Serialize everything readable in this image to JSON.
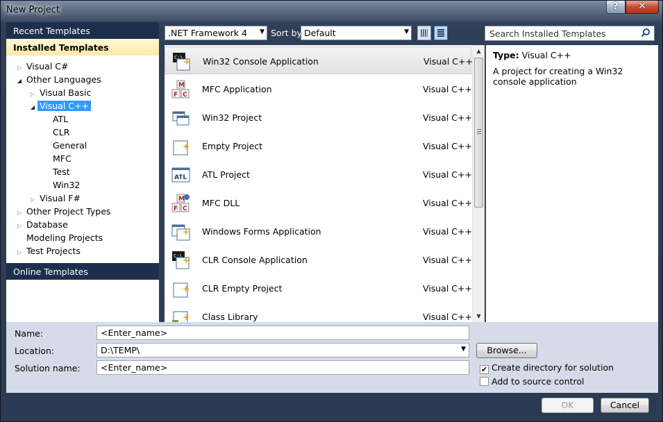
{
  "window": {
    "title": "New Project",
    "help_label": "?",
    "close_label": "✕"
  },
  "left": {
    "recent_label": "Recent Templates",
    "installed_label": "Installed Templates",
    "online_label": "Online Templates",
    "tree": [
      {
        "label": "Visual C#",
        "expander": "collapsed"
      },
      {
        "label": "Other Languages",
        "expander": "expanded"
      },
      {
        "label": "Visual Basic",
        "expander": "collapsed"
      },
      {
        "label": "Visual C++",
        "expander": "expanded",
        "selected": true
      },
      {
        "label": "ATL",
        "expander": "none"
      },
      {
        "label": "CLR",
        "expander": "none"
      },
      {
        "label": "General",
        "expander": "none"
      },
      {
        "label": "MFC",
        "expander": "none"
      },
      {
        "label": "Test",
        "expander": "none"
      },
      {
        "label": "Win32",
        "expander": "none"
      },
      {
        "label": "Visual F#",
        "expander": "collapsed"
      },
      {
        "label": "Other Project Types",
        "expander": "collapsed"
      },
      {
        "label": "Database",
        "expander": "collapsed"
      },
      {
        "label": "Modeling Projects",
        "expander": "none"
      },
      {
        "label": "Test Projects",
        "expander": "collapsed"
      }
    ]
  },
  "toolbar": {
    "framework_value": ".NET Framework 4",
    "sortby_label": "Sort by:",
    "sortby_value": "Default"
  },
  "search": {
    "placeholder": "Search Installed Templates"
  },
  "templates": [
    {
      "name": "Win32 Console Application",
      "lang": "Visual C++",
      "icon": "console-app-icon",
      "selected": true
    },
    {
      "name": "MFC Application",
      "lang": "Visual C++",
      "icon": "mfc-app-icon"
    },
    {
      "name": "Win32 Project",
      "lang": "Visual C++",
      "icon": "win32-project-icon"
    },
    {
      "name": "Empty Project",
      "lang": "Visual C++",
      "icon": "empty-project-icon"
    },
    {
      "name": "ATL Project",
      "lang": "Visual C++",
      "icon": "atl-project-icon"
    },
    {
      "name": "MFC DLL",
      "lang": "Visual C++",
      "icon": "mfc-dll-icon"
    },
    {
      "name": "Windows Forms Application",
      "lang": "Visual C++",
      "icon": "winforms-app-icon"
    },
    {
      "name": "CLR Console Application",
      "lang": "Visual C++",
      "icon": "clr-console-icon"
    },
    {
      "name": "CLR Empty Project",
      "lang": "Visual C++",
      "icon": "clr-empty-icon"
    },
    {
      "name": "Class Library",
      "lang": "Visual C++",
      "icon": "class-library-icon"
    }
  ],
  "description": {
    "type_label": "Type:",
    "type_value": "Visual C++",
    "text": "A project for creating a Win32 console application"
  },
  "form": {
    "name_label": "Name:",
    "name_value": "<Enter_name>",
    "location_label": "Location:",
    "location_value": "D:\\TEMP\\",
    "solution_label": "Solution name:",
    "solution_value": "<Enter_name>",
    "browse_label": "Browse...",
    "create_dir_label": "Create directory for solution",
    "create_dir_checked": true,
    "source_control_label": "Add to source control",
    "source_control_checked": false
  },
  "footer": {
    "ok_label": "OK",
    "cancel_label": "Cancel"
  },
  "colors": {
    "selection": "#3399ff",
    "header_dark": "#1c2f4d",
    "installed_highlight": "#ffe9a8",
    "form_bg": "#d6dbe9"
  }
}
